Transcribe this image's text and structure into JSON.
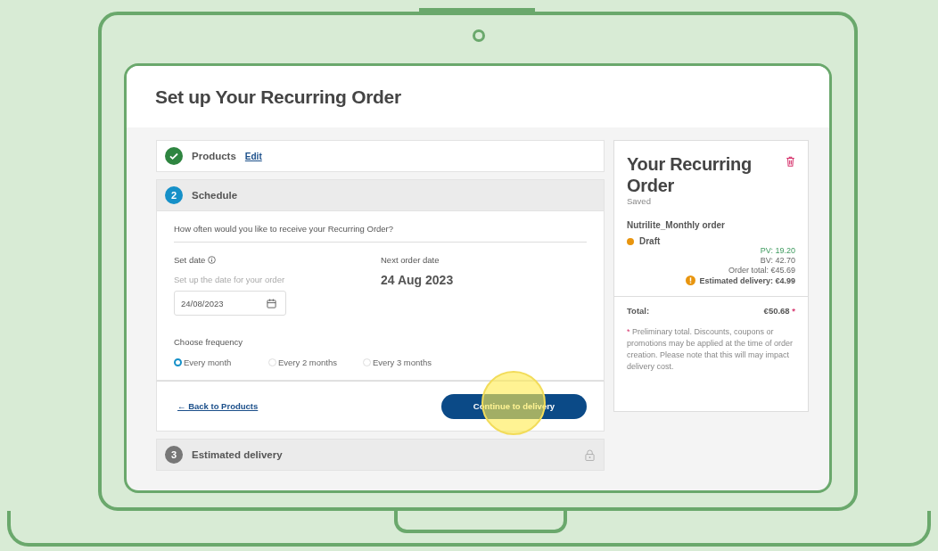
{
  "page_title": "Set up Your Recurring Order",
  "steps": [
    {
      "kind": "done",
      "label": "Products",
      "link": "Edit"
    },
    {
      "kind": "active",
      "number": "2",
      "label": "Schedule"
    },
    {
      "kind": "locked",
      "number": "3",
      "label": "Estimated delivery"
    }
  ],
  "schedule": {
    "question": "How often would you like to receive your Recurring Order?",
    "set_date_label": "Set date",
    "set_date_hint": "Set up the date for your order",
    "date_value": "24/08/2023",
    "next_label": "Next order date",
    "next_date": "24 Aug 2023",
    "frequency_label": "Choose frequency",
    "frequencies": [
      {
        "label": "Every month",
        "selected": true
      },
      {
        "label": "Every 2 months",
        "selected": false
      },
      {
        "label": "Every 3 months",
        "selected": false
      }
    ],
    "back_link": "← Back to Products",
    "continue_button": "Continue to delivery"
  },
  "summary": {
    "title": "Your Recurring Order",
    "saved": "Saved",
    "order_name": "Nutrilite_Monthly order",
    "status": {
      "label": "Draft",
      "color": "#e8950f"
    },
    "pv": "PV: 19.20",
    "bv": "BV: 42.70",
    "order_total": "Order total: €45.69",
    "delivery": "Estimated delivery: €4.99",
    "total_label": "Total:",
    "total_value": "€50.68",
    "asterisk": "*",
    "note": "Preliminary total. Discounts, coupons or promotions may be applied at the time of order creation. Please note that this will may impact delivery cost."
  }
}
